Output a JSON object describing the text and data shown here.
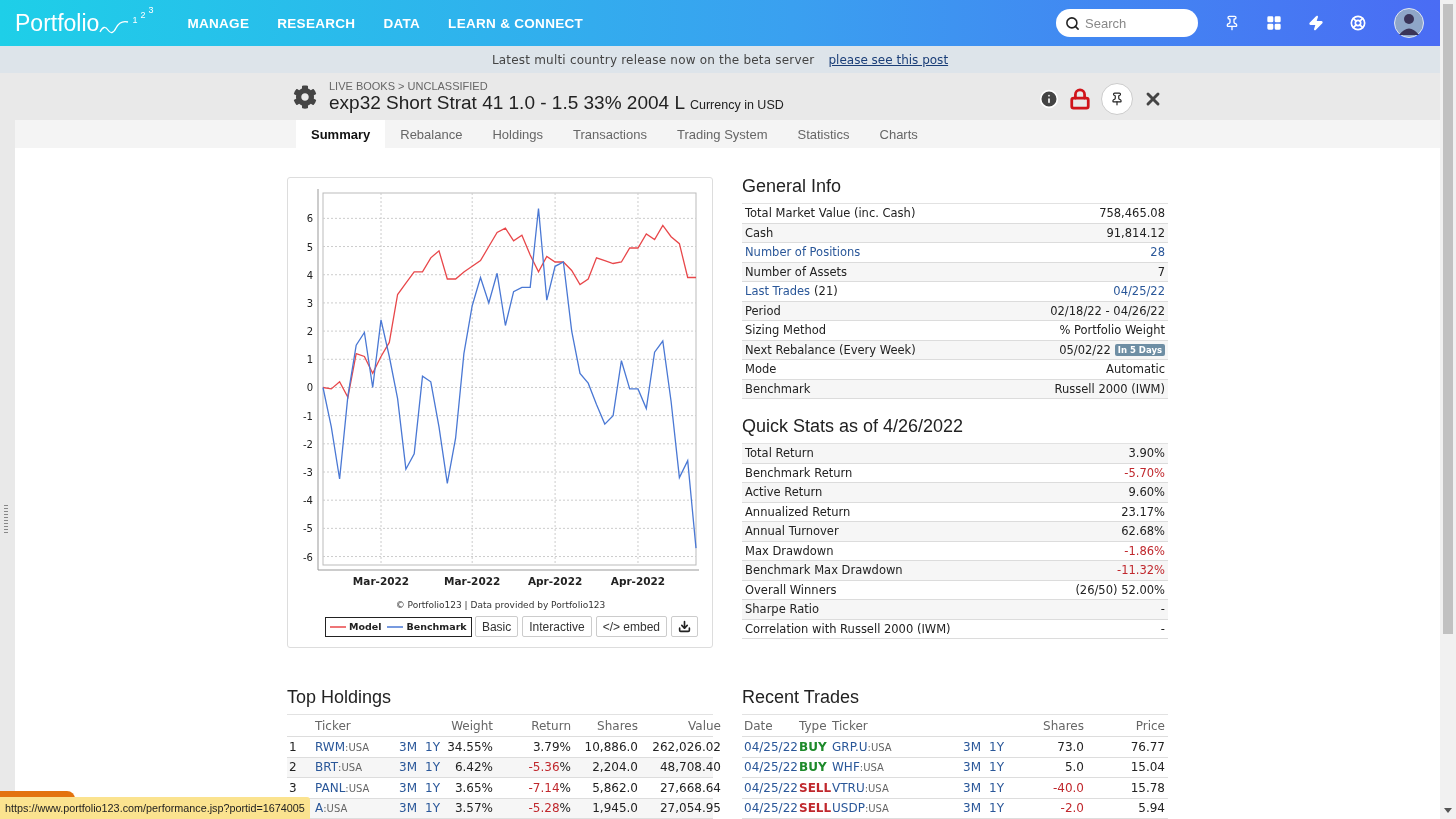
{
  "nav": {
    "logo": {
      "name": "Portfolio",
      "digits": [
        "1",
        "2",
        "3"
      ]
    },
    "menu": [
      "MANAGE",
      "RESEARCH",
      "DATA",
      "LEARN & CONNECT"
    ],
    "search": {
      "placeholder": "Search"
    }
  },
  "banner": {
    "text": "Latest multi country release now on the beta server",
    "link": "please see this post"
  },
  "header": {
    "breadcrumb": "LIVE BOOKS > UNCLASSIFIED",
    "title": "exp32 Short Strat 41 1.0 - 1.5 33% 2004 L",
    "currency": "Currency in USD"
  },
  "tabs": [
    {
      "label": "Summary",
      "selected": true
    },
    {
      "label": "Rebalance",
      "selected": false
    },
    {
      "label": "Holdings",
      "selected": false
    },
    {
      "label": "Transactions",
      "selected": false
    },
    {
      "label": "Trading System",
      "selected": false
    },
    {
      "label": "Statistics",
      "selected": false
    },
    {
      "label": "Charts",
      "selected": false
    }
  ],
  "chart": {
    "credit": "© Portfolio123 | Data provided by Portfolio123",
    "buttons": [
      "Basic",
      "Interactive",
      "</> embed"
    ],
    "chart_data": {
      "type": "line",
      "grid": true,
      "categories": [
        null,
        null,
        null,
        null,
        null,
        null,
        null,
        "Mar-2022",
        null,
        null,
        null,
        null,
        null,
        null,
        null,
        null,
        null,
        null,
        "Mar-2022",
        null,
        null,
        null,
        null,
        null,
        null,
        null,
        null,
        null,
        "Apr-2022",
        null,
        null,
        null,
        null,
        null,
        null,
        null,
        null,
        null,
        "Apr-2022",
        null,
        null,
        null,
        null,
        null,
        null,
        null
      ],
      "ylim": [
        -6.3,
        6.9
      ],
      "yticks": [
        -6,
        -5,
        -4,
        -3,
        -2,
        -1,
        0,
        1,
        2,
        3,
        4,
        5,
        6
      ],
      "series": [
        {
          "name": "Model",
          "color": "#e8474a",
          "values": [
            0,
            -0.05,
            0.2,
            -0.35,
            1.2,
            1.1,
            0.5,
            1.1,
            1.6,
            3.3,
            3.7,
            4.1,
            4.1,
            4.6,
            4.85,
            3.85,
            3.85,
            4.1,
            4.3,
            4.5,
            5.0,
            5.5,
            5.65,
            5.2,
            5.4,
            4.7,
            4.1,
            4.65,
            4.45,
            4.45,
            4.15,
            3.65,
            3.85,
            4.6,
            4.5,
            4.4,
            4.45,
            4.95,
            4.95,
            5.45,
            5.25,
            5.75,
            5.35,
            5.1,
            3.9,
            3.9
          ]
        },
        {
          "name": "Benchmark",
          "color": "#4a78d4",
          "values": [
            0,
            -1.4,
            -3.25,
            -0.3,
            1.5,
            1.95,
            0,
            2.4,
            1.1,
            -0.4,
            -2.9,
            -2.35,
            0.4,
            0.2,
            -1.4,
            -3.4,
            -1.8,
            1.2,
            2.9,
            3.9,
            3.0,
            4.05,
            2.2,
            3.4,
            3.55,
            3.55,
            6.35,
            3.1,
            4.3,
            4.45,
            2.0,
            0.5,
            0.15,
            -0.6,
            -1.3,
            -1.0,
            0.95,
            -0.05,
            -0.05,
            -0.75,
            1.25,
            1.65,
            -0.5,
            -3.2,
            -2.6,
            -5.7
          ]
        }
      ]
    }
  },
  "general_info": {
    "title": "General Info",
    "rows": [
      {
        "label": "Total Market Value (inc. Cash)",
        "value": "758,465.08",
        "link": false
      },
      {
        "label": "Cash",
        "value": "91,814.12",
        "link": false
      },
      {
        "label": "Number of Positions",
        "value": "28",
        "link": true
      },
      {
        "label": "Number of Assets",
        "value": "7",
        "link": false
      },
      {
        "label": "Last Trades",
        "label_suffix": "(21)",
        "value": "04/25/22",
        "link": true
      },
      {
        "label": "Period",
        "value": "02/18/22 - 04/26/22",
        "link": false
      },
      {
        "label": "Sizing Method",
        "value": "% Portfolio Weight",
        "link": false
      },
      {
        "label": "Next Rebalance (Every Week)",
        "value": "05/02/22",
        "badge": "In 5 Days",
        "link": false
      },
      {
        "label": "Mode",
        "value": "Automatic",
        "link": false
      },
      {
        "label": "Benchmark",
        "value": "Russell 2000 (IWM)",
        "link": false
      }
    ]
  },
  "quick_stats": {
    "title": "Quick Stats as of 4/26/2022",
    "rows": [
      {
        "label": "Total Return",
        "value": "3.90%",
        "negative": false
      },
      {
        "label": "Benchmark Return",
        "value": "-5.70%",
        "negative": true
      },
      {
        "label": "Active Return",
        "value": "9.60%",
        "negative": false
      },
      {
        "label": "Annualized Return",
        "value": "23.17%",
        "negative": false
      },
      {
        "label": "Annual Turnover",
        "value": "62.68%",
        "negative": false
      },
      {
        "label": "Max Drawdown",
        "value": "-1.86%",
        "negative": true
      },
      {
        "label": "Benchmark Max Drawdown",
        "value": "-11.32%",
        "negative": true
      },
      {
        "label": "Overall Winners",
        "value": "(26/50) 52.00%",
        "negative": false
      },
      {
        "label": "Sharpe Ratio",
        "value": "-",
        "negative": false
      },
      {
        "label": "Correlation with Russell 2000 (IWM)",
        "value": "-",
        "negative": false
      }
    ]
  },
  "top_holdings": {
    "title": "Top Holdings",
    "columns": [
      "Ticker",
      "Weight",
      "Return",
      "Shares",
      "Value"
    ],
    "rows": [
      {
        "num": "1",
        "ticker": "RWM",
        "exchange": ":USA",
        "links": [
          "3M",
          "1Y"
        ],
        "weight": "34.55%",
        "return": "3.79",
        "unit": "%",
        "negative": false,
        "shares": "10,886.0",
        "value": "262,026.02"
      },
      {
        "num": "2",
        "ticker": "BRT",
        "exchange": ":USA",
        "links": [
          "3M",
          "1Y"
        ],
        "weight": "6.42%",
        "return": "-5.36",
        "unit": "%",
        "negative": true,
        "shares": "2,204.0",
        "value": "48,708.40"
      },
      {
        "num": "3",
        "ticker": "PANL",
        "exchange": ":USA",
        "links": [
          "3M",
          "1Y"
        ],
        "weight": "3.65%",
        "return": "-7.14",
        "unit": "%",
        "negative": true,
        "shares": "5,862.0",
        "value": "27,668.64"
      },
      {
        "ticker": "A",
        "exchange": ":USA",
        "links": [
          "3M",
          "1Y"
        ],
        "weight": "3.57%",
        "return": "-5.28",
        "unit": "%",
        "negative": true,
        "shares": "1,945.0",
        "value": "27,054.95"
      }
    ]
  },
  "recent_trades": {
    "title": "Recent Trades",
    "columns": [
      "Date",
      "Type",
      "Ticker",
      "Shares",
      "Price"
    ],
    "rows": [
      {
        "date": "04/25/22",
        "type": "BUY",
        "kind": "buy",
        "ticker": "GRP.U",
        "exchange": ":USA",
        "links": [
          "3M",
          "1Y"
        ],
        "shares": "73.0",
        "negative": false,
        "price": "76.77"
      },
      {
        "date": "04/25/22",
        "type": "BUY",
        "kind": "buy",
        "ticker": "WHF",
        "exchange": ":USA",
        "links": [
          "3M",
          "1Y"
        ],
        "shares": "5.0",
        "negative": false,
        "price": "15.04"
      },
      {
        "date": "04/25/22",
        "type": "SELL",
        "kind": "sell",
        "ticker": "VTRU",
        "exchange": ":USA",
        "links": [
          "3M",
          "1Y"
        ],
        "shares": "-40.0",
        "negative": true,
        "price": "15.78"
      },
      {
        "date": "04/25/22",
        "type": "SELL",
        "kind": "sell",
        "ticker": "USDP",
        "exchange": ":USA",
        "links": [
          "3M",
          "1Y"
        ],
        "shares": "-2.0",
        "negative": true,
        "price": "5.94"
      }
    ]
  },
  "status_bar": {
    "url": "https://www.portfolio123.com/performance.jsp?portid=1674005"
  }
}
